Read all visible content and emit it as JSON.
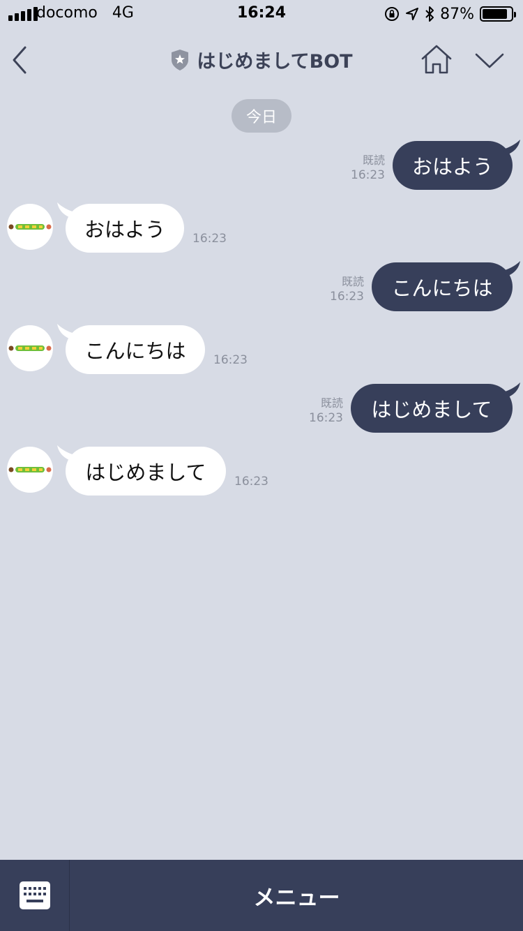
{
  "status_bar": {
    "carrier": "docomo",
    "network": "4G",
    "time": "16:24",
    "battery_percent": "87%",
    "battery_level": 0.87,
    "icons": [
      "signal-icon",
      "orientation-lock-icon",
      "location-icon",
      "bluetooth-icon",
      "battery-icon"
    ]
  },
  "header": {
    "title": "はじめましてBOT",
    "icons": [
      "back-icon",
      "official-shield-icon",
      "home-icon",
      "chevron-down-icon"
    ]
  },
  "date_chip": "今日",
  "messages": [
    {
      "side": "out",
      "text": "おはよう",
      "read": "既読",
      "time": "16:23"
    },
    {
      "side": "in",
      "text": "おはよう",
      "time": "16:23"
    },
    {
      "side": "out",
      "text": "こんにちは",
      "read": "既読",
      "time": "16:23"
    },
    {
      "side": "in",
      "text": "こんにちは",
      "time": "16:23"
    },
    {
      "side": "out",
      "text": "はじめまして",
      "read": "既読",
      "time": "16:23"
    },
    {
      "side": "in",
      "text": "はじめまして",
      "time": "16:23"
    }
  ],
  "bottom_bar": {
    "keyboard_icon": "keyboard-icon",
    "menu_label": "メニュー"
  },
  "colors": {
    "background": "#d7dbe5",
    "outgoing_bubble": "#373f5a",
    "incoming_bubble": "#ffffff",
    "bottom_bar": "#373f5a"
  }
}
